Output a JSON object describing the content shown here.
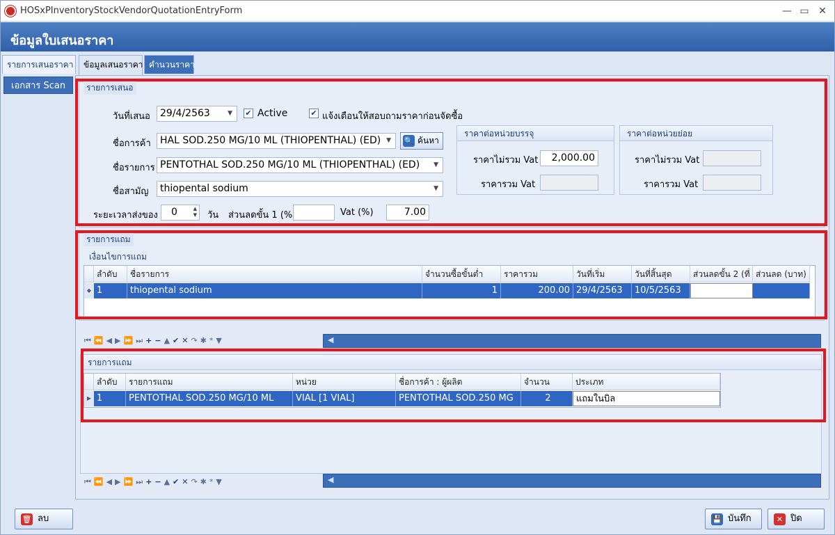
{
  "window": {
    "title": "HOSxPInventoryStockVendorQuotationEntryForm",
    "header": "ข้อมูลใบเสนอราคา"
  },
  "tabs": [
    "รายการเสนอราคา",
    "ข้อมูลเสนอราคา",
    "คำนวนราคา"
  ],
  "leftnav": {
    "scan": "เอกสาร Scan"
  },
  "offer": {
    "caption": "รายการเสนอ",
    "date_label": "วันที่เสนอ",
    "date_value": "29/4/2563",
    "active_label": "Active",
    "active_checked": true,
    "notify_label": "แจ้งเตือนให้สอบถามราคาก่อนจัดซื้อ",
    "notify_checked": true,
    "trade_label": "ชื่อการค้า",
    "trade_value": "HAL SOD.250 MG/10 ML (THIOPENTHAL) (ED)",
    "search_button": "ค้นหา",
    "item_label": "ชื่อรายการ",
    "item_value": "PENTOTHAL SOD.250 MG/10 ML (THIOPENTHAL) (ED)",
    "generic_label": "ชื่อสามัญ",
    "generic_value": "thiopental sodium",
    "lead_label": "ระยะเวลาส่งของ",
    "lead_value": "0",
    "lead_unit": "วัน",
    "discount1_label": "ส่วนลดขั้น 1 (%)",
    "discount1_value": "",
    "vat_label": "Vat (%)",
    "vat_value": "7.00"
  },
  "pack_price": {
    "title": "ราคาต่อหน่วยบรรจุ",
    "excl_label": "ราคาไม่รวม Vat",
    "excl_value": "2,000.00",
    "incl_label": "ราคารวม Vat",
    "incl_value": ""
  },
  "unit_price": {
    "title": "ราคาต่อหน่วยย่อย",
    "excl_label": "ราคาไม่รวม Vat",
    "excl_value": "",
    "incl_label": "ราคารวม Vat",
    "incl_value": ""
  },
  "free_section": {
    "caption": "รายการแถม",
    "condition_title": "เงื่อนไขการแถม",
    "columns": [
      "ลำดับ",
      "ชื่อรายการ",
      "จำนวนซื้อขั้นต่ำ",
      "ราคารวม",
      "วันที่เริ่ม",
      "วันที่สิ้นสุด",
      "ส่วนลดขั้น 2 (ที่",
      "ส่วนลด (บาท)"
    ],
    "rows": [
      [
        "1",
        "thiopental sodium",
        "1",
        "200.00",
        "29/4/2563",
        "10/5/2563",
        "",
        ""
      ]
    ]
  },
  "free_items": {
    "title": "รายการแถม",
    "columns": [
      "ลำดับ",
      "รายการแถม",
      "หน่วย",
      "ชื่อการค้า : ผู้ผลิต",
      "จำนวน",
      "ประเภท"
    ],
    "rows": [
      [
        "1",
        "PENTOTHAL SOD.250 MG/10 ML",
        "VIAL [1 VIAL]",
        "PENTOTHAL SOD.250 MG",
        "2",
        "แถมในบิล"
      ]
    ]
  },
  "footer": {
    "delete_button": "ลบ",
    "save_button": "บันทึก",
    "close_button": "ปิด"
  },
  "colors": {
    "header": "#3d6fb8",
    "selected_row": "#2f66c4",
    "highlight": "#e4161e"
  }
}
